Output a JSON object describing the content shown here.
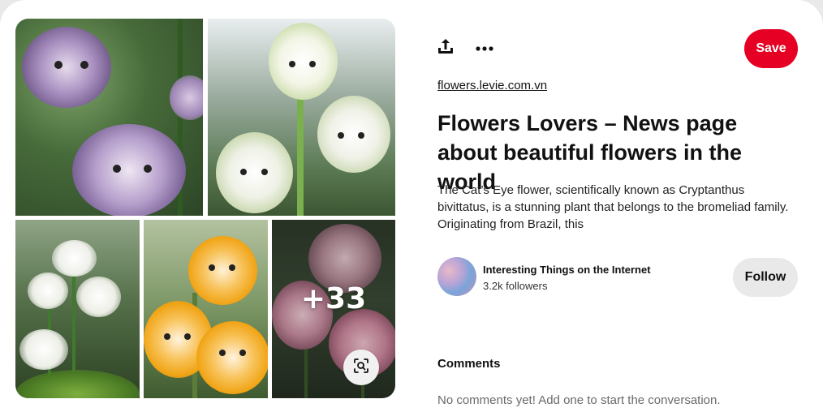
{
  "pin": {
    "source": "flowers.levie.com.vn",
    "title": "Flowers Lovers – News page about beautiful flowers in the world",
    "description": "The Cat’s Eye flower, scientifically knoᴡn as Cryptanthus bivittatus, is a stunning plant that belongs to the bromeliad family. Originating from Brazil, this"
  },
  "toolbar": {
    "share_icon": "share-icon",
    "more_icon": "more-options-icon",
    "save_label": "Save"
  },
  "gallery": {
    "more_count": "+33",
    "lens_icon": "visual-search-icon"
  },
  "creator": {
    "name": "Interesting Things on the Internet",
    "followers": "3.2k followers",
    "follow_label": "Follow"
  },
  "comments": {
    "heading": "Comments",
    "empty_text": "No comments yet! Add one to start the conversation."
  },
  "colors": {
    "save_button": "#e60023",
    "follow_button": "#e9e9e9",
    "text_primary": "#111111",
    "text_muted": "#6a6a6a"
  }
}
